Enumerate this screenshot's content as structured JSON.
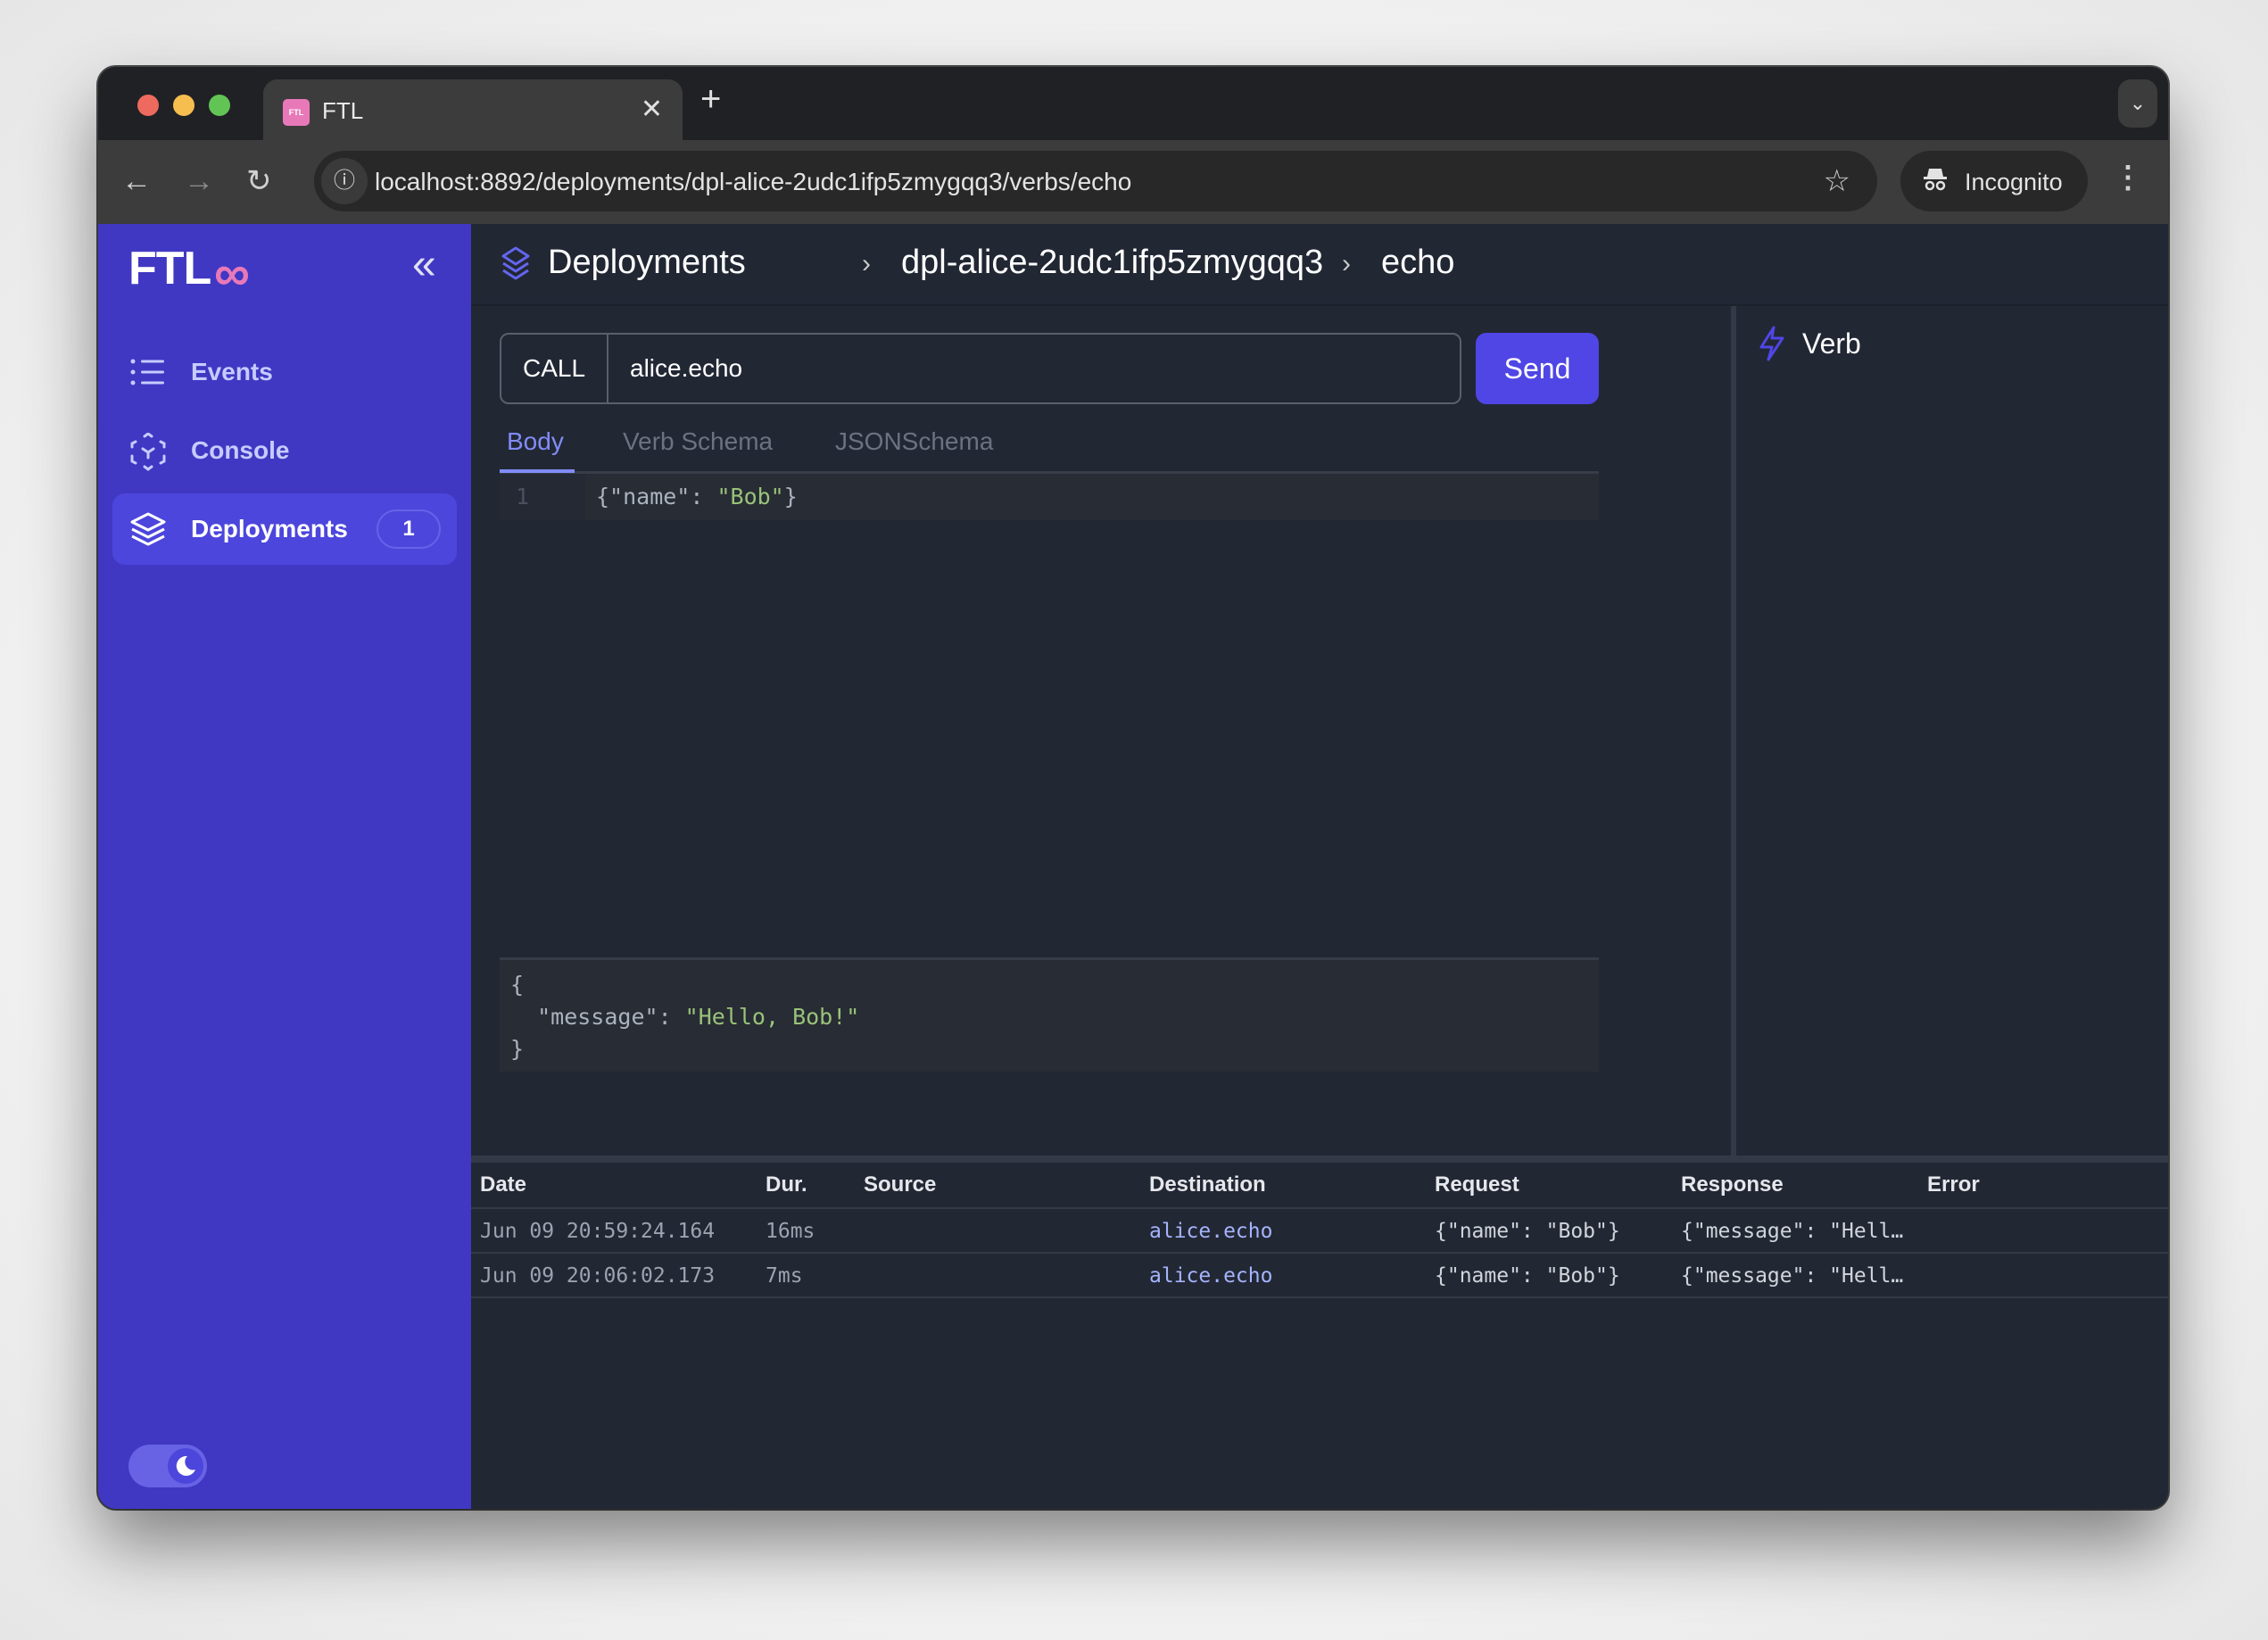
{
  "browser": {
    "tab_title": "FTL",
    "tab_favicon_text": "FTL",
    "url": "localhost:8892/deployments/dpl-alice-2udc1ifp5zmygqq3/verbs/echo",
    "profile_label": "Incognito"
  },
  "sidebar": {
    "logo_text": "FTL",
    "logo_symbol": "∞",
    "items": [
      {
        "label": "Events",
        "icon": "list-icon",
        "active": false
      },
      {
        "label": "Console",
        "icon": "cube-scan-icon",
        "active": false
      },
      {
        "label": "Deployments",
        "icon": "layers-icon",
        "active": true,
        "badge": "1"
      }
    ],
    "theme": "dark"
  },
  "breadcrumb": {
    "items": [
      "Deployments",
      "dpl-alice-2udc1ifp5zmygqq3",
      "echo"
    ],
    "separator": "›"
  },
  "request": {
    "method_label": "CALL",
    "verb_value": "alice.echo",
    "send_label": "Send",
    "tabs": [
      {
        "label": "Body",
        "active": true
      },
      {
        "label": "Verb Schema",
        "active": false
      },
      {
        "label": "JSONSchema",
        "active": false
      }
    ],
    "body_line_number": "1",
    "body_prefix": "{\"name\": ",
    "body_string": "\"Bob\"",
    "body_suffix": "}"
  },
  "response": {
    "line1": "{",
    "key": "  \"message\": ",
    "value": "\"Hello, Bob!\"",
    "line3": "}"
  },
  "verb_panel": {
    "title": "Verb"
  },
  "calls_table": {
    "columns": [
      "Date",
      "Dur.",
      "Source",
      "Destination",
      "Request",
      "Response",
      "Error"
    ],
    "rows": [
      {
        "date": "Jun 09 20:59:24.164",
        "duration": "16ms",
        "source": "",
        "destination": "alice.echo",
        "request": "{\"name\": \"Bob\"}",
        "response": "{\"message\": \"Hell…",
        "error": ""
      },
      {
        "date": "Jun 09 20:06:02.173",
        "duration": "7ms",
        "source": "",
        "destination": "alice.echo",
        "request": "{\"name\": \"Bob\"}",
        "response": "{\"message\": \"Hell…",
        "error": ""
      }
    ]
  },
  "colors": {
    "sidebar_bg": "#4038c3",
    "accent": "#4f46e5",
    "main_bg": "#222734",
    "string": "#98c379",
    "logo_symbol": "#e879b9"
  }
}
